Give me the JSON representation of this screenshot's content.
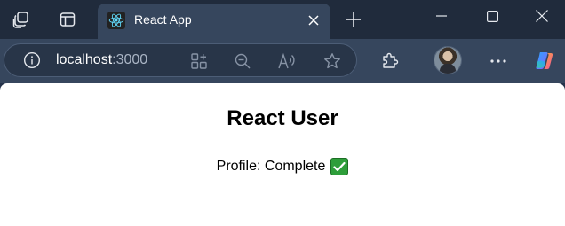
{
  "tab": {
    "title": "React App"
  },
  "address_bar": {
    "host": "localhost",
    "port": ":3000"
  },
  "icons": {
    "workspaces": "workspaces-icon",
    "tab_actions": "tab-actions-icon",
    "favicon": "react-logo-icon",
    "close_tab": "close-icon",
    "new_tab": "plus-icon",
    "minimize": "minimize-icon",
    "maximize": "maximize-icon",
    "close_window": "close-icon",
    "site_info": "info-icon",
    "add_to_app": "app-available-icon",
    "zoom_out": "zoom-out-icon",
    "read_aloud": "read-aloud-icon",
    "favorite": "star-icon",
    "extensions": "puzzle-icon",
    "settings_more": "more-icon",
    "copilot": "copilot-icon"
  },
  "page": {
    "heading": "React User",
    "profile_label": "Profile: Complete",
    "status_emoji": "check-mark-icon"
  },
  "colors": {
    "check_green": "#2e9e3a",
    "react_cyan": "#61dafb"
  }
}
